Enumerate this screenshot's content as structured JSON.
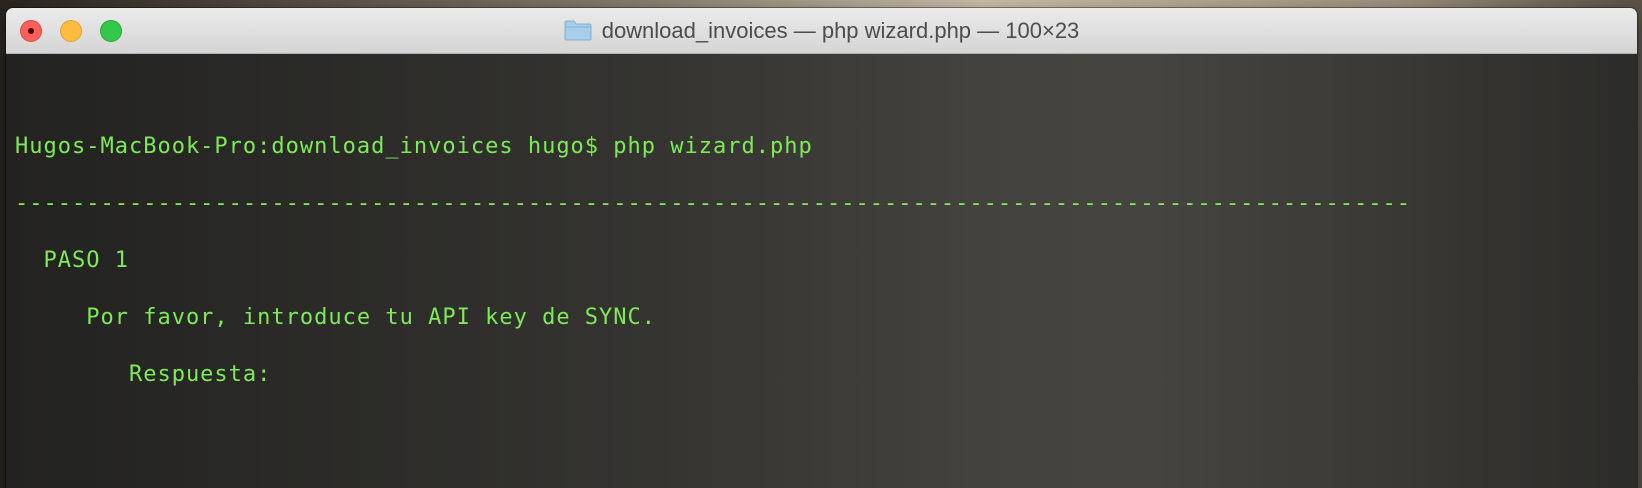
{
  "window": {
    "title": "download_invoices — php wizard.php — 100×23",
    "title_icon": "folder-icon",
    "buttons": {
      "close": "close-button",
      "minimize": "minimize-button",
      "zoom": "zoom-button"
    }
  },
  "terminal": {
    "prompt": "Hugos-MacBook-Pro:download_invoices hugo$ php wizard.php",
    "separator": "--------------------------------------------------------------------------------------------------",
    "step_title": "  PASO 1",
    "question": "     Por favor, introduce tu API key de SYNC.",
    "answer_label": "        Respuesta:"
  },
  "colors": {
    "terminal_text": "#7dea57",
    "terminal_background": "#2d2d2b",
    "close": "#fc605b",
    "minimize": "#fdbc40",
    "zoom": "#34c84a"
  }
}
